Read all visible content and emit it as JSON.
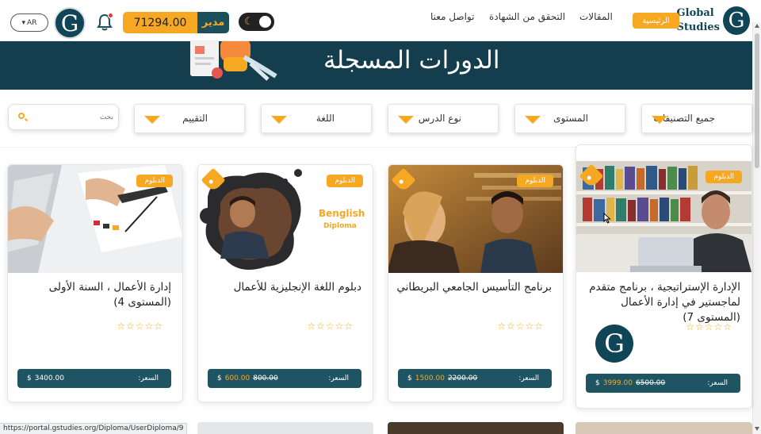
{
  "header": {
    "logo_text_line1": "Global",
    "logo_text_line2": "Studies",
    "logo_letter": "G",
    "home_label": "الرئيسية",
    "nav": {
      "articles": "المقالات",
      "certificate": "التحقق من الشهادة",
      "contact": "تواصل معنا"
    },
    "wallet_amount": "71294.00",
    "role_label": "مدير",
    "language": "AR",
    "language_icon": "caret-down-icon",
    "theme_icon": "moon-icon",
    "notification_icon": "bell-icon"
  },
  "banner": {
    "title": "الدورات المسجلة"
  },
  "filters": {
    "categories": "جميع التصنيفات",
    "level": "المستوى",
    "lesson_type": "نوع الدرس",
    "language": "اللغة",
    "rating": "التقييم",
    "search_placeholder": "بحث"
  },
  "courses": [
    {
      "badge": "الدبلوم",
      "title": "الإدارة الإستراتيجية ، برنامج متقدم لماجستير في إدارة الأعمال (المستوى 7)",
      "stars": "☆☆☆☆☆",
      "price_label": "السعر:",
      "old_price": "6500.00",
      "new_price": "3999.00",
      "currency": "$"
    },
    {
      "badge": "الدبلوم",
      "title": "برنامج التأسيس الجامعي البريطاني",
      "stars": "☆☆☆☆☆",
      "price_label": "السعر:",
      "old_price": "2200.00",
      "new_price": "1500.00",
      "currency": "$"
    },
    {
      "badge": "الدبلوم",
      "title": "دبلوم اللغة الإنجليزية للأعمال",
      "stars": "☆☆☆☆☆",
      "price_label": "السعر:",
      "old_price": "800.00",
      "new_price": "600.00",
      "currency": "$",
      "image_text_1": "Benglish",
      "image_text_2": "Diploma"
    },
    {
      "badge": "الدبلوم",
      "title": "إدارة الأعمال ، السنة الأولى (المستوى 4)",
      "stars": "☆☆☆☆☆",
      "price_label": "السعر:",
      "price": "3400.00",
      "currency": "$"
    }
  ],
  "status_url": "https://portal.gstudies.org/Diploma/UserDiploma/9",
  "colors": {
    "accent": "#f7a823",
    "brand": "#143e4d",
    "price_bar": "#1f5563"
  }
}
